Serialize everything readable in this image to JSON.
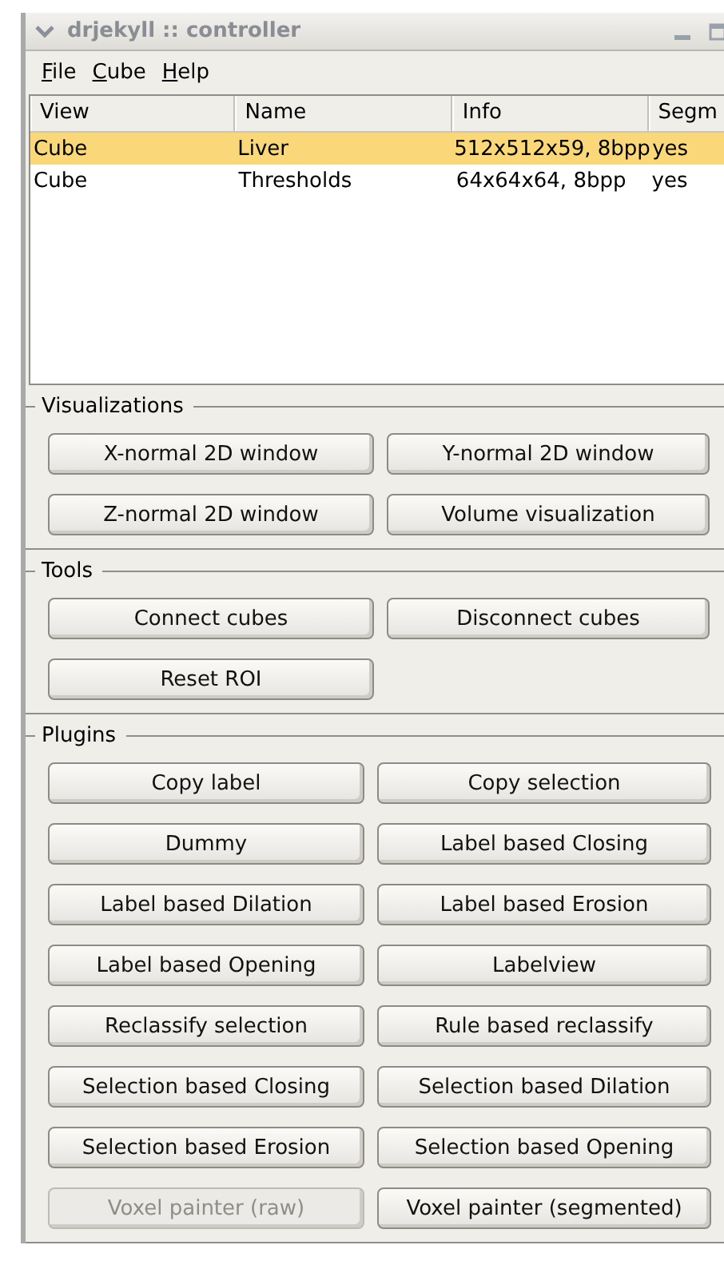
{
  "window": {
    "title": "drjekyll :: controller"
  },
  "menu": [
    {
      "mnemonic": "F",
      "rest": "ile"
    },
    {
      "mnemonic": "C",
      "rest": "ube"
    },
    {
      "mnemonic": "H",
      "rest": "elp"
    }
  ],
  "table": {
    "columns": [
      "View",
      "Name",
      "Info",
      "Segm"
    ],
    "rows": [
      {
        "cells": [
          "Cube",
          "Liver",
          "512x512x59, 8bpp",
          "yes"
        ],
        "selected": true
      },
      {
        "cells": [
          "Cube",
          "Thresholds",
          "64x64x64, 8bpp",
          "yes"
        ],
        "selected": false
      }
    ]
  },
  "groups": [
    {
      "title": "Visualizations",
      "buttons": [
        {
          "label": "X-normal 2D window",
          "disabled": false
        },
        {
          "label": "Y-normal 2D window",
          "disabled": false
        },
        {
          "label": "Z-normal 2D window",
          "disabled": false
        },
        {
          "label": "Volume visualization",
          "disabled": false
        }
      ]
    },
    {
      "title": "Tools",
      "buttons": [
        {
          "label": "Connect cubes",
          "disabled": false
        },
        {
          "label": "Disconnect cubes",
          "disabled": false
        },
        {
          "label": "Reset ROI",
          "disabled": false
        }
      ]
    },
    {
      "title": "Plugins",
      "buttons": [
        {
          "label": "Copy label",
          "disabled": false
        },
        {
          "label": "Copy selection",
          "disabled": false
        },
        {
          "label": "Dummy",
          "disabled": false
        },
        {
          "label": "Label based Closing",
          "disabled": false
        },
        {
          "label": "Label based Dilation",
          "disabled": false
        },
        {
          "label": "Label based Erosion",
          "disabled": false
        },
        {
          "label": "Label based Opening",
          "disabled": false
        },
        {
          "label": "Labelview",
          "disabled": false
        },
        {
          "label": "Reclassify selection",
          "disabled": false
        },
        {
          "label": "Rule based reclassify",
          "disabled": false
        },
        {
          "label": "Selection based Closing",
          "disabled": false
        },
        {
          "label": "Selection based Dilation",
          "disabled": false
        },
        {
          "label": "Selection based Erosion",
          "disabled": false
        },
        {
          "label": "Selection based Opening",
          "disabled": false
        },
        {
          "label": "Voxel painter (raw)",
          "disabled": true
        },
        {
          "label": "Voxel painter (segmented)",
          "disabled": false
        }
      ]
    }
  ]
}
